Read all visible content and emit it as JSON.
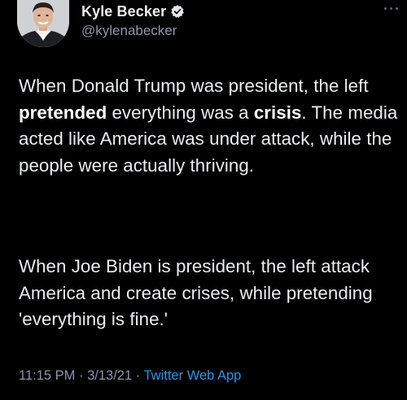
{
  "author": {
    "display_name": "Kyle Becker",
    "handle": "@kylenabecker",
    "verified": true
  },
  "icons": {
    "verified": "verified-badge-icon",
    "more": "more-options-icon",
    "avatar": "profile-photo"
  },
  "tweet": {
    "paragraph1": {
      "seg1": "When Donald Trump was president, the left ",
      "seg2_bold": "pretended",
      "seg3": " everything was a ",
      "seg4_bold": "crisis",
      "seg5": ". The media acted like America was under attack, while the people were actually thriving."
    },
    "paragraph2": "When Joe Biden is president, the left attack America and create crises, while pretending 'everything is fine.'"
  },
  "meta": {
    "time": "11:15 PM",
    "separator1": " · ",
    "date": "3/13/21",
    "separator2": " · ",
    "source": "Twitter Web App"
  },
  "colors": {
    "background": "#000000",
    "text": "#e7e9ea",
    "secondary": "#8b98a5",
    "accent": "#1d9bf0"
  }
}
